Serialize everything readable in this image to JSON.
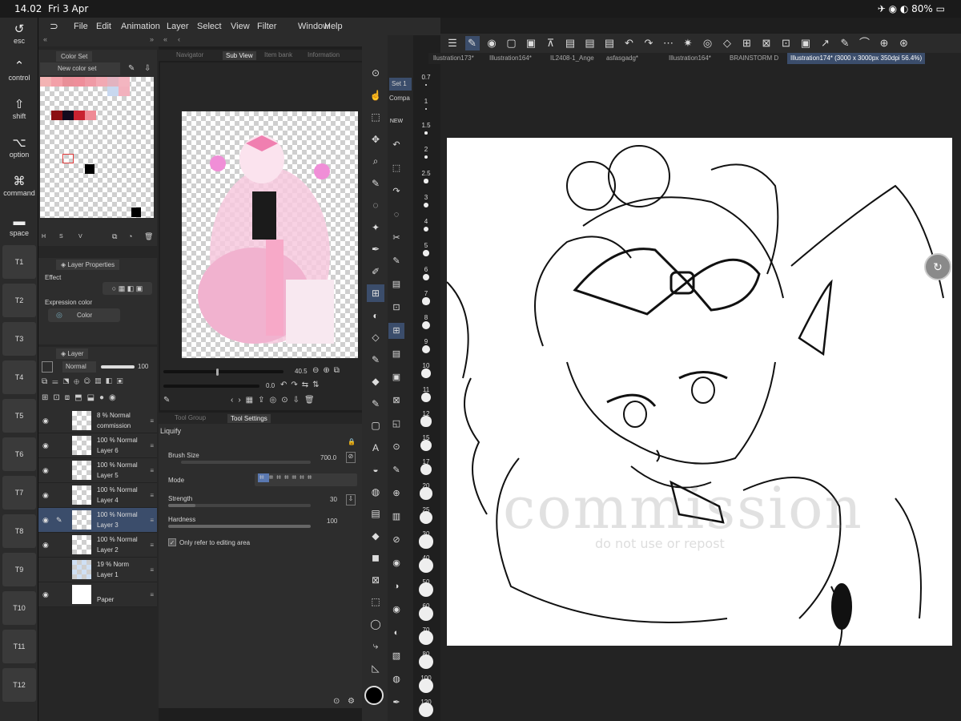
{
  "status": {
    "time": "14.02",
    "date": "Fri 3 Apr",
    "battery": "80%"
  },
  "modifiers": [
    {
      "icon": "↺",
      "label": "esc"
    },
    {
      "icon": "⌃",
      "label": "control"
    },
    {
      "icon": "⇧",
      "label": "shift"
    },
    {
      "icon": "⌥",
      "label": "option"
    },
    {
      "icon": "⌘",
      "label": "command"
    },
    {
      "icon": "▬",
      "label": "space"
    }
  ],
  "tkeys": [
    "T1",
    "T2",
    "T3",
    "T4",
    "T5",
    "T6",
    "T7",
    "T8",
    "T9",
    "T10",
    "T11",
    "T12"
  ],
  "menu": [
    "File",
    "Edit",
    "Animation",
    "Layer",
    "Select",
    "View",
    "Filter",
    "Window",
    "Help"
  ],
  "colorset": {
    "tab": "Color Set",
    "name": "New color set"
  },
  "subview_tabs": [
    "Navigator",
    "Sub View",
    "Item bank",
    "Information"
  ],
  "navigator": {
    "zoom": "40.5",
    "angle": "0.0"
  },
  "layer_props": {
    "tab": "Layer Properties",
    "effect": "Effect",
    "expression_label": "Expression color",
    "expression_value": "Color"
  },
  "layer_panel": {
    "tab": "Layer",
    "blend": "Normal",
    "opacity": "100"
  },
  "layers": [
    {
      "blend": "8 %  Normal",
      "name": "commission"
    },
    {
      "blend": "100 %  Normal",
      "name": "Layer 6"
    },
    {
      "blend": "100 %  Normal",
      "name": "Layer 5"
    },
    {
      "blend": "100 %  Normal",
      "name": "Layer 4"
    },
    {
      "blend": "100 %  Normal",
      "name": "Layer 3"
    },
    {
      "blend": "100 %  Normal",
      "name": "Layer 2"
    },
    {
      "blend": "19 %  Norm",
      "name": "Layer 1"
    },
    {
      "blend": "",
      "name": "Paper"
    }
  ],
  "tool_tabs": [
    "Tool Group",
    "Tool Settings"
  ],
  "tool_settings": {
    "tool": "Liquify",
    "brush_size_label": "Brush Size",
    "brush_size": "700.0",
    "mode_label": "Mode",
    "strength_label": "Strength",
    "strength": "30",
    "hardness_label": "Hardness",
    "hardness": "100",
    "only_refer": "Only refer to editing area"
  },
  "subtool": {
    "set": "Set 1",
    "compa": "Compa"
  },
  "brush_sizes": [
    "0.7",
    "1",
    "1.5",
    "2",
    "2.5",
    "3",
    "4",
    "5",
    "6",
    "7",
    "8",
    "9",
    "10",
    "11",
    "12",
    "15",
    "17",
    "20",
    "25",
    "30",
    "40",
    "50",
    "60",
    "70",
    "80",
    "100",
    "120"
  ],
  "doc_tabs": [
    "llustration173*",
    "Illustration164*",
    "IL2408-1_Ange",
    "asfasgadg*",
    "Illustration164*",
    "BRAINSTORM D"
  ],
  "active_doc": "Illustration174* (3000 x 3000px 350dpi 56.4%)",
  "watermark": {
    "main": "commission",
    "sub": "do not use or repost"
  },
  "colors": {
    "accent": "#3b4d6b",
    "pink": "#f2b6cf"
  }
}
